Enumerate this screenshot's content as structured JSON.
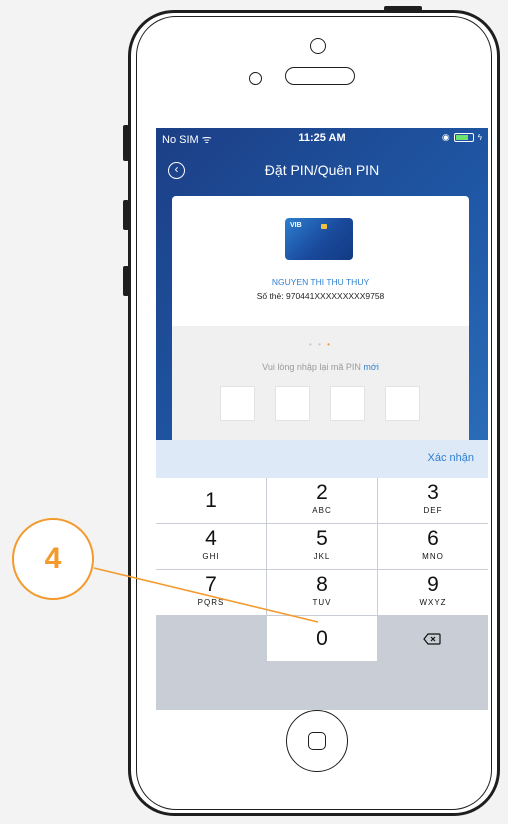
{
  "status_bar": {
    "carrier": "No SIM ᯤ",
    "time": "11:25 AM"
  },
  "header": {
    "title": "Đặt PIN/Quên PIN",
    "back_icon": "back-circle-icon"
  },
  "card": {
    "bank_logo": "VIB",
    "holder_name": "NGUYEN THI THU THUY",
    "number": "Số thẻ: 970441XXXXXXXXX9758"
  },
  "pin": {
    "prompt": "Vui lòng nhập lại mã PIN",
    "prompt_accent": "mới",
    "step_dots": [
      "•",
      "•",
      "•"
    ],
    "active_step": 3,
    "digits": [
      "",
      "",
      "",
      ""
    ]
  },
  "toolbar": {
    "confirm_label": "Xác nhận"
  },
  "keypad": {
    "keys": [
      {
        "num": "1",
        "letters": ""
      },
      {
        "num": "2",
        "letters": "ABC"
      },
      {
        "num": "3",
        "letters": "DEF"
      },
      {
        "num": "4",
        "letters": "GHI"
      },
      {
        "num": "5",
        "letters": "JKL"
      },
      {
        "num": "6",
        "letters": "MNO"
      },
      {
        "num": "7",
        "letters": "PQRS"
      },
      {
        "num": "8",
        "letters": "TUV"
      },
      {
        "num": "9",
        "letters": "WXYZ"
      },
      {
        "num": "",
        "letters": ""
      },
      {
        "num": "0",
        "letters": ""
      },
      {
        "num": "",
        "letters": ""
      }
    ],
    "delete_icon": "backspace-icon"
  },
  "annotation": {
    "step_number": "4",
    "color": "#f39a2c"
  }
}
